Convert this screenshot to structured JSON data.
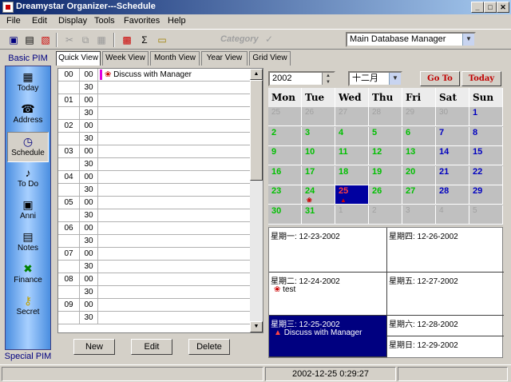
{
  "window": {
    "title": "Dreamystar Organizer---Schedule"
  },
  "menu": [
    "File",
    "Edit",
    "Display",
    "Tools",
    "Favorites",
    "Help"
  ],
  "toolbar": {
    "category_label": "Category",
    "database": "Main Database Manager"
  },
  "sidebar": {
    "header": "Basic PIM",
    "footer": "Special PIM",
    "items": [
      {
        "label": "Today",
        "icon": "calendar-icon"
      },
      {
        "label": "Address",
        "icon": "phone-icon"
      },
      {
        "label": "Schedule",
        "icon": "schedule-icon"
      },
      {
        "label": "To Do",
        "icon": "note-icon"
      },
      {
        "label": "Anni",
        "icon": "anniversary-icon"
      },
      {
        "label": "Notes",
        "icon": "notes-icon"
      },
      {
        "label": "Finance",
        "icon": "finance-icon"
      },
      {
        "label": "Secret",
        "icon": "key-icon"
      }
    ]
  },
  "tabs": [
    "Quick View",
    "Week View",
    "Month View",
    "Year View",
    "Grid View"
  ],
  "dayview": {
    "slots": [
      {
        "hour": "00",
        "min": "00",
        "event": "Discuss with Manager"
      },
      {
        "hour": "",
        "min": "30",
        "event": ""
      },
      {
        "hour": "01",
        "min": "00",
        "event": ""
      },
      {
        "hour": "",
        "min": "30",
        "event": ""
      },
      {
        "hour": "02",
        "min": "00",
        "event": ""
      },
      {
        "hour": "",
        "min": "30",
        "event": ""
      },
      {
        "hour": "03",
        "min": "00",
        "event": ""
      },
      {
        "hour": "",
        "min": "30",
        "event": ""
      },
      {
        "hour": "04",
        "min": "00",
        "event": ""
      },
      {
        "hour": "",
        "min": "30",
        "event": ""
      },
      {
        "hour": "05",
        "min": "00",
        "event": ""
      },
      {
        "hour": "",
        "min": "30",
        "event": ""
      },
      {
        "hour": "06",
        "min": "00",
        "event": ""
      },
      {
        "hour": "",
        "min": "30",
        "event": ""
      },
      {
        "hour": "07",
        "min": "00",
        "event": ""
      },
      {
        "hour": "",
        "min": "30",
        "event": ""
      },
      {
        "hour": "08",
        "min": "00",
        "event": ""
      },
      {
        "hour": "",
        "min": "30",
        "event": ""
      },
      {
        "hour": "09",
        "min": "00",
        "event": ""
      },
      {
        "hour": "",
        "min": "30",
        "event": ""
      }
    ],
    "buttons": {
      "new": "New",
      "edit": "Edit",
      "delete": "Delete"
    }
  },
  "calendar": {
    "year": "2002",
    "month": "十二月",
    "goto": "Go To",
    "today": "Today",
    "days": [
      "Mon",
      "Tue",
      "Wed",
      "Thu",
      "Fri",
      "Sat",
      "Sun"
    ],
    "weeks": [
      [
        "25",
        "26",
        "27",
        "28",
        "29",
        "30",
        "1"
      ],
      [
        "2",
        "3",
        "4",
        "5",
        "6",
        "7",
        "8"
      ],
      [
        "9",
        "10",
        "11",
        "12",
        "13",
        "14",
        "15"
      ],
      [
        "16",
        "17",
        "18",
        "19",
        "20",
        "21",
        "22"
      ],
      [
        "23",
        "24",
        "25",
        "26",
        "27",
        "28",
        "29"
      ],
      [
        "30",
        "31",
        "1",
        "2",
        "3",
        "4",
        "5"
      ]
    ]
  },
  "week": {
    "mon": {
      "title": "星期一: 12-23-2002",
      "event": ""
    },
    "tue": {
      "title": "星期二: 12-24-2002",
      "event": "test"
    },
    "wed": {
      "title": "星期三: 12-25-2002",
      "event": "Discuss with Manager"
    },
    "thu": {
      "title": "星期四: 12-26-2002",
      "event": ""
    },
    "fri": {
      "title": "星期五: 12-27-2002",
      "event": ""
    },
    "sat": {
      "title": "星期六: 12-28-2002",
      "event": ""
    },
    "sun": {
      "title": "星期日: 12-29-2002",
      "event": ""
    }
  },
  "status": {
    "datetime": "2002-12-25   0:29:27"
  }
}
